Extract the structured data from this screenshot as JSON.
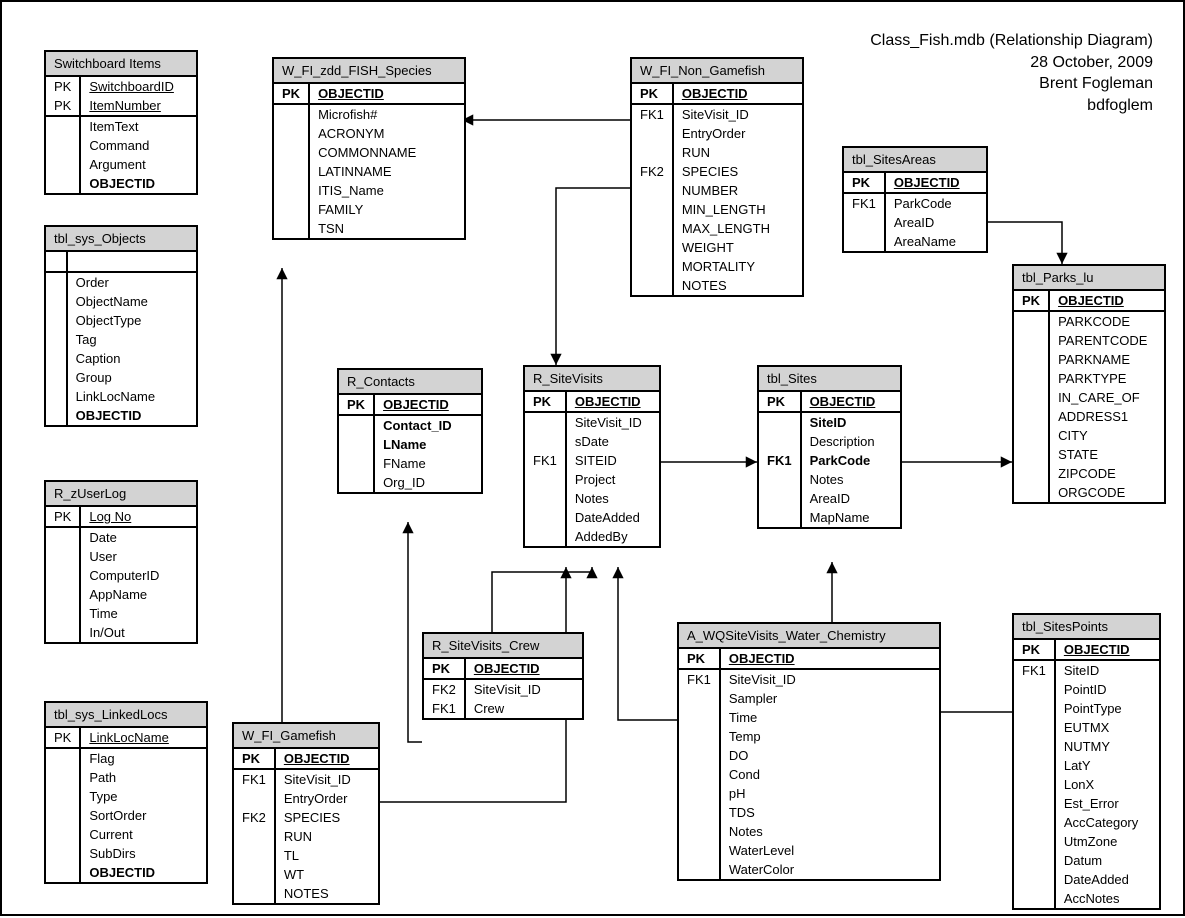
{
  "header": {
    "line1": "Class_Fish.mdb (Relationship Diagram)",
    "line2": "28 October, 2009",
    "line3": "Brent Fogleman",
    "line4": "bdfoglem"
  },
  "entities": {
    "switchboard": {
      "title": "Switchboard Items",
      "pk_rows": [
        {
          "key": "PK",
          "field": "SwitchboardID",
          "underline": true
        },
        {
          "key": "PK",
          "field": "ItemNumber",
          "underline": true
        }
      ],
      "fields": [
        "ItemText",
        "Command",
        "Argument"
      ],
      "bold_fields": [
        "OBJECTID"
      ]
    },
    "sys_objects": {
      "title": "tbl_sys_Objects",
      "pk_rows": [
        {
          "key": "",
          "field": ""
        }
      ],
      "fields": [
        "Order",
        "ObjectName",
        "ObjectType",
        "Tag",
        "Caption",
        "Group",
        "LinkLocName"
      ],
      "bold_fields": [
        "OBJECTID"
      ]
    },
    "zuserlog": {
      "title": "R_zUserLog",
      "pk_rows": [
        {
          "key": "PK",
          "field": "Log No",
          "underline": true
        }
      ],
      "fields": [
        "Date",
        "User",
        "ComputerID",
        "AppName",
        "Time",
        "In/Out"
      ]
    },
    "linkedlocs": {
      "title": "tbl_sys_LinkedLocs",
      "pk_rows": [
        {
          "key": "PK",
          "field": "LinkLocName",
          "underline": true
        }
      ],
      "fields": [
        "Flag",
        "Path",
        "Type",
        "SortOrder",
        "Current",
        "SubDirs"
      ],
      "bold_fields": [
        "OBJECTID"
      ]
    },
    "zdd_species": {
      "title": "W_FI_zdd_FISH_Species",
      "pk_rows": [
        {
          "key": "PK",
          "field": "OBJECTID",
          "underline": true,
          "bold": true
        }
      ],
      "fields": [
        "Microfish#",
        "ACRONYM",
        "COMMONNAME",
        "LATINNAME",
        "ITIS_Name",
        "FAMILY",
        "TSN"
      ]
    },
    "contacts": {
      "title": "R_Contacts",
      "pk_rows": [
        {
          "key": "PK",
          "field": "OBJECTID",
          "underline": true,
          "bold": true
        }
      ],
      "bold_fields_top": [
        "Contact_ID",
        "LName"
      ],
      "fields": [
        "FName",
        "Org_ID"
      ]
    },
    "gamefish": {
      "title": "W_FI_Gamefish",
      "pk_rows": [
        {
          "key": "PK",
          "field": "OBJECTID",
          "underline": true,
          "bold": true
        }
      ],
      "key_rows": [
        {
          "key": "FK1",
          "field": "SiteVisit_ID"
        },
        {
          "key": "",
          "field": "EntryOrder"
        },
        {
          "key": "FK2",
          "field": "SPECIES"
        },
        {
          "key": "",
          "field": "RUN"
        },
        {
          "key": "",
          "field": "TL"
        },
        {
          "key": "",
          "field": "WT"
        },
        {
          "key": "",
          "field": "NOTES"
        }
      ]
    },
    "nongamefish": {
      "title": "W_FI_Non_Gamefish",
      "pk_rows": [
        {
          "key": "PK",
          "field": "OBJECTID",
          "underline": true,
          "bold": true
        }
      ],
      "key_rows": [
        {
          "key": "FK1",
          "field": "SiteVisit_ID"
        },
        {
          "key": "",
          "field": "EntryOrder"
        },
        {
          "key": "",
          "field": "RUN"
        },
        {
          "key": "FK2",
          "field": "SPECIES"
        },
        {
          "key": "",
          "field": "NUMBER"
        },
        {
          "key": "",
          "field": "MIN_LENGTH"
        },
        {
          "key": "",
          "field": "MAX_LENGTH"
        },
        {
          "key": "",
          "field": "WEIGHT"
        },
        {
          "key": "",
          "field": "MORTALITY"
        },
        {
          "key": "",
          "field": "NOTES"
        }
      ]
    },
    "sitevisits": {
      "title": "R_SiteVisits",
      "pk_rows": [
        {
          "key": "PK",
          "field": "OBJECTID",
          "underline": true,
          "bold": true
        }
      ],
      "key_rows": [
        {
          "key": "",
          "field": "SiteVisit_ID"
        },
        {
          "key": "",
          "field": "sDate"
        },
        {
          "key": "FK1",
          "field": "SITEID"
        },
        {
          "key": "",
          "field": "Project"
        },
        {
          "key": "",
          "field": "Notes"
        },
        {
          "key": "",
          "field": "DateAdded"
        },
        {
          "key": "",
          "field": "AddedBy"
        }
      ]
    },
    "crew": {
      "title": "R_SiteVisits_Crew",
      "pk_rows": [
        {
          "key": "PK",
          "field": "OBJECTID",
          "underline": true,
          "bold": true
        }
      ],
      "key_rows": [
        {
          "key": "FK2",
          "field": "SiteVisit_ID"
        },
        {
          "key": "FK1",
          "field": "Crew"
        }
      ]
    },
    "wq": {
      "title": "A_WQSiteVisits_Water_Chemistry",
      "pk_rows": [
        {
          "key": "PK",
          "field": "OBJECTID",
          "underline": true,
          "bold": true
        }
      ],
      "key_rows": [
        {
          "key": "FK1",
          "field": "SiteVisit_ID"
        },
        {
          "key": "",
          "field": "Sampler"
        },
        {
          "key": "",
          "field": "Time"
        },
        {
          "key": "",
          "field": "Temp"
        },
        {
          "key": "",
          "field": "DO"
        },
        {
          "key": "",
          "field": "Cond"
        },
        {
          "key": "",
          "field": "pH"
        },
        {
          "key": "",
          "field": "TDS"
        },
        {
          "key": "",
          "field": "Notes"
        },
        {
          "key": "",
          "field": "WaterLevel"
        },
        {
          "key": "",
          "field": "WaterColor"
        }
      ]
    },
    "sites": {
      "title": "tbl_Sites",
      "pk_rows": [
        {
          "key": "PK",
          "field": "OBJECTID",
          "underline": true,
          "bold": true
        }
      ],
      "key_rows": [
        {
          "key": "",
          "field": "SiteID",
          "bold": true
        },
        {
          "key": "",
          "field": "Description"
        },
        {
          "key": "FK1",
          "field": "ParkCode",
          "bold": true
        },
        {
          "key": "",
          "field": "Notes"
        },
        {
          "key": "",
          "field": "AreaID"
        },
        {
          "key": "",
          "field": "MapName"
        }
      ]
    },
    "sitesareas": {
      "title": "tbl_SitesAreas",
      "pk_rows": [
        {
          "key": "PK",
          "field": "OBJECTID",
          "underline": true,
          "bold": true
        }
      ],
      "key_rows": [
        {
          "key": "FK1",
          "field": "ParkCode"
        },
        {
          "key": "",
          "field": "AreaID"
        },
        {
          "key": "",
          "field": "AreaName"
        }
      ]
    },
    "parks": {
      "title": "tbl_Parks_lu",
      "pk_rows": [
        {
          "key": "PK",
          "field": "OBJECTID",
          "underline": true,
          "bold": true
        }
      ],
      "fields": [
        "PARKCODE",
        "PARENTCODE",
        "PARKNAME",
        "PARKTYPE",
        "IN_CARE_OF",
        "ADDRESS1",
        "CITY",
        "STATE",
        "ZIPCODE",
        "ORGCODE"
      ]
    },
    "sitespoints": {
      "title": "tbl_SitesPoints",
      "pk_rows": [
        {
          "key": "PK",
          "field": "OBJECTID",
          "underline": true,
          "bold": true
        }
      ],
      "key_rows": [
        {
          "key": "FK1",
          "field": "SiteID"
        },
        {
          "key": "",
          "field": "PointID"
        },
        {
          "key": "",
          "field": "PointType"
        },
        {
          "key": "",
          "field": "EUTMX"
        },
        {
          "key": "",
          "field": "NUTMY"
        },
        {
          "key": "",
          "field": "LatY"
        },
        {
          "key": "",
          "field": "LonX"
        },
        {
          "key": "",
          "field": "Est_Error"
        },
        {
          "key": "",
          "field": "AccCategory"
        },
        {
          "key": "",
          "field": "UtmZone"
        },
        {
          "key": "",
          "field": "Datum"
        },
        {
          "key": "",
          "field": "DateAdded"
        },
        {
          "key": "",
          "field": "AccNotes"
        }
      ]
    }
  }
}
